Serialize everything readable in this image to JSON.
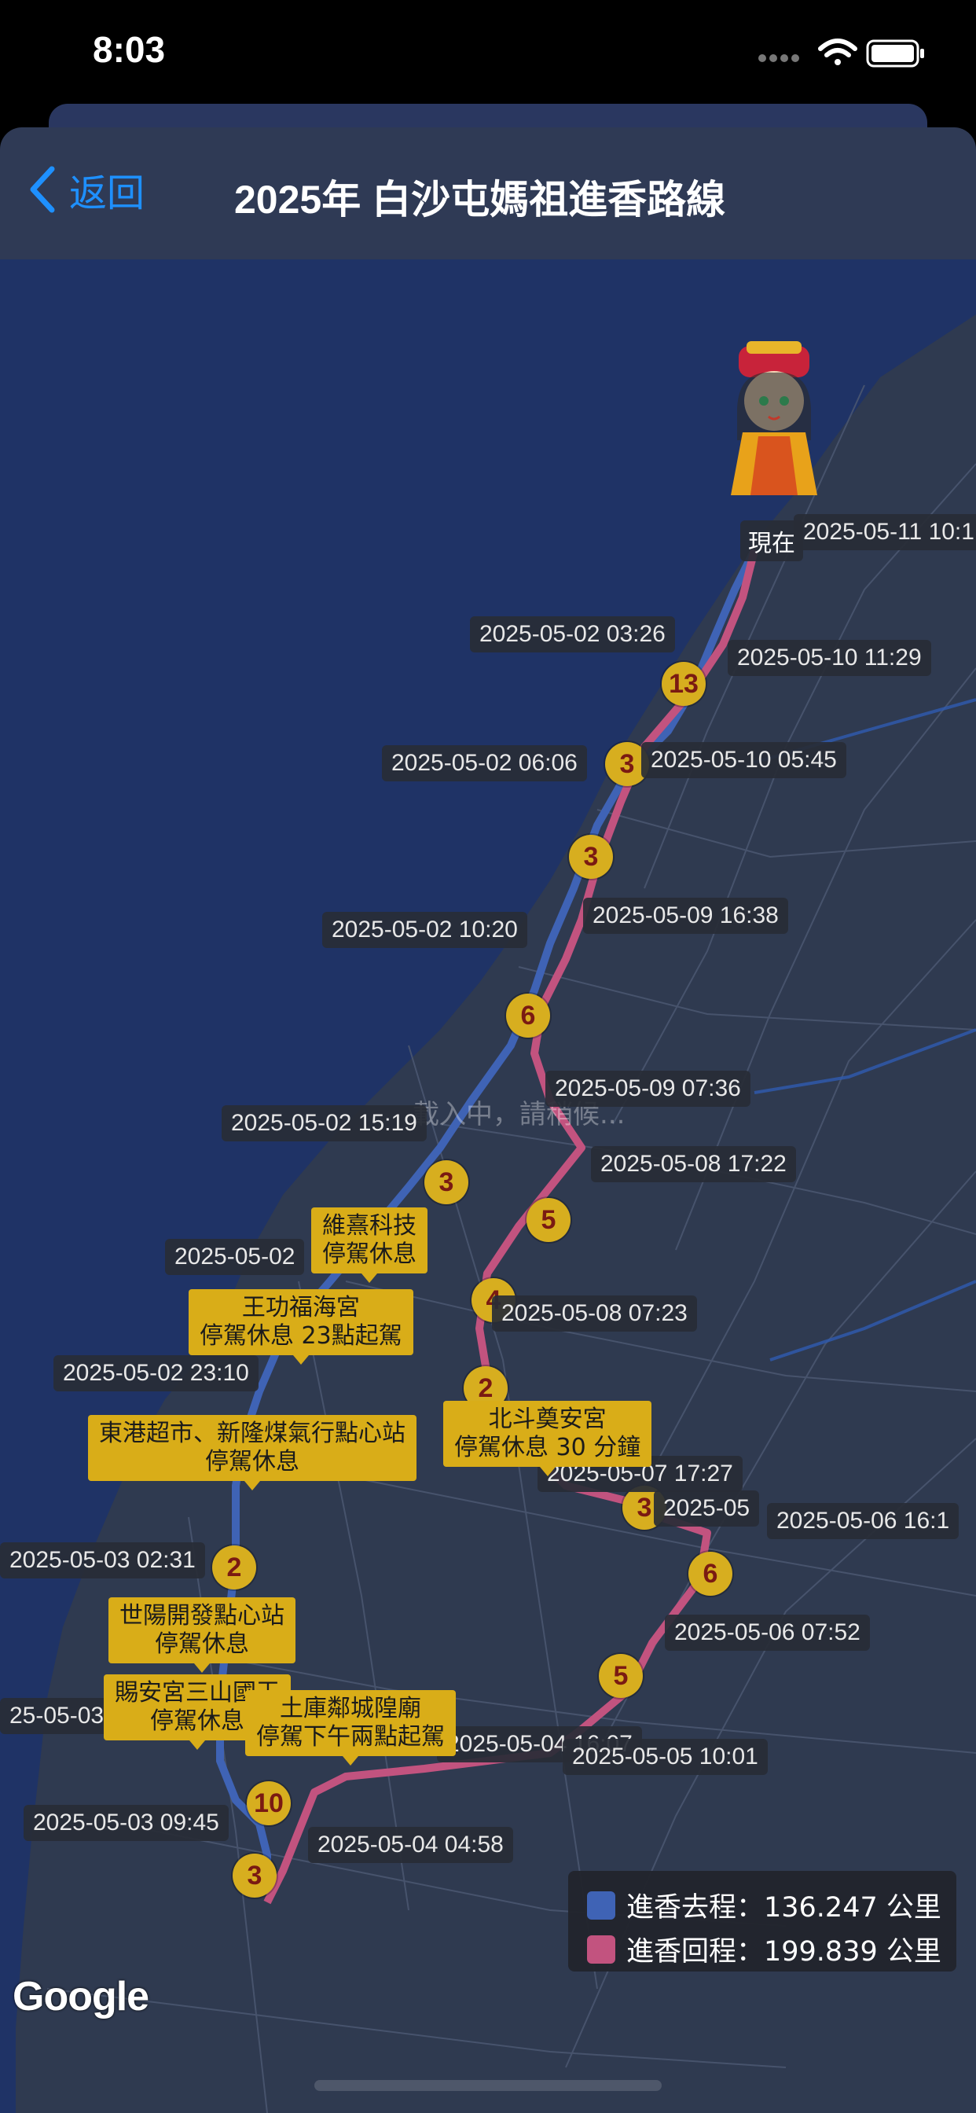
{
  "status_bar": {
    "time": "8:03"
  },
  "nav": {
    "back_label": "返回",
    "title": "2025年 白沙屯媽祖進香路線"
  },
  "map": {
    "loading_text": "載入中，請稍候...",
    "now_label": "現在",
    "brand": "Google",
    "markers": [
      "13",
      "3",
      "3",
      "6",
      "3",
      "5",
      "4",
      "2",
      "2",
      "10",
      "3",
      "6",
      "5",
      "3"
    ],
    "time_labels": [
      "2025-05-11 10:1",
      "2025-05-02 03:26",
      "2025-05-10 11:29",
      "2025-05-02 06:06",
      "2025-05-10 05:45",
      "2025-05-02 10:20",
      "2025-05-09 16:38",
      "2025-05-09 07:36",
      "2025-05-02 15:19",
      "2025-05-08 17:22",
      "2025-05-02",
      "2025-05-08 07:23",
      "2025-05-02 23:10",
      "2025-05-07 17:27",
      "2025-05",
      "2025-05-06 16:1",
      "2025-05-03 02:31",
      "2025-05-06 07:52",
      "25-05-03",
      "2025-05-04 16:07",
      "2025-05-05 10:01",
      "2025-05-03 09:45",
      "2025-05-04 04:58"
    ],
    "stops": [
      {
        "line1": "維熹科技",
        "line2": "停駕休息"
      },
      {
        "line1": "王功福海宮",
        "line2": "停駕休息 23點起駕"
      },
      {
        "line1": "東港超市、新隆煤氣行點心站",
        "line2": "停駕休息"
      },
      {
        "line1": "北斗奠安宮",
        "line2": "停駕休息 30 分鐘"
      },
      {
        "line1": "世陽開發點心站",
        "line2": "停駕休息"
      },
      {
        "line1": "賜安宮三山國王",
        "line2": "停駕休息"
      },
      {
        "line1": "土庫鄰城隍廟",
        "line2": "停駕下午兩點起駕"
      }
    ]
  },
  "legend": {
    "outbound": {
      "label": "進香去程：136.247 公里",
      "color": "#3f63b5"
    },
    "return": {
      "label": "進香回程：199.839 公里",
      "color": "#c2537f"
    }
  }
}
